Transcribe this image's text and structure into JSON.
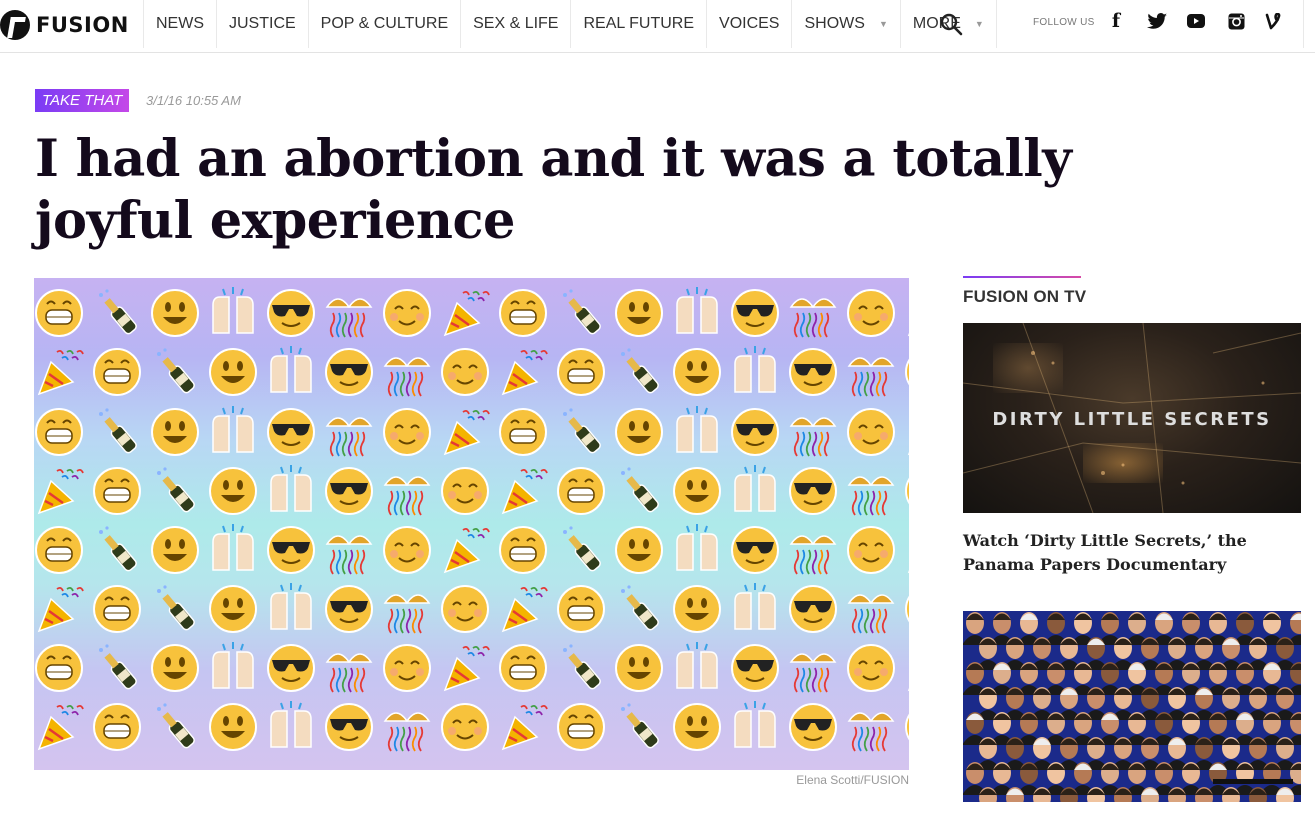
{
  "brand": {
    "name": "FUSION",
    "logo_icon": "fusion-logo-icon"
  },
  "nav": {
    "items": [
      {
        "label": "NEWS"
      },
      {
        "label": "JUSTICE"
      },
      {
        "label": "POP & CULTURE"
      },
      {
        "label": "SEX & LIFE"
      },
      {
        "label": "REAL FUTURE"
      },
      {
        "label": "VOICES"
      },
      {
        "label": "SHOWS",
        "dropdown": true
      },
      {
        "label": "MORE",
        "dropdown": true
      }
    ],
    "search_icon": "search-icon",
    "follow_label": "FOLLOW US",
    "social": [
      "facebook-icon",
      "twitter-icon",
      "youtube-icon",
      "instagram-icon",
      "vine-icon"
    ]
  },
  "article": {
    "tag": "TAKE THAT",
    "date": "3/1/16 10:55 AM",
    "headline": "I had an abortion and it was a totally joyful experience",
    "image_credit": "Elena Scotti/FUSION",
    "image_emojis": [
      "grinning-emoji",
      "champagne-emoji",
      "smiley-emoji",
      "raised-hands-emoji",
      "sunglasses-emoji",
      "confetti-ball-emoji",
      "relaxed-emoji",
      "party-popper-emoji"
    ]
  },
  "sidebar": {
    "section_title": "FUSION ON TV",
    "video_overlay": "DIRTY LITTLE SECRETS",
    "story_title": "Watch ‘Dirty Little Secrets,’ the Panama Papers Documentary"
  },
  "colors": {
    "accent_purple": "#7a3cf5",
    "accent_pink": "#c448e8",
    "headline": "#140a1c",
    "people_bg": "#1b2a8a"
  }
}
